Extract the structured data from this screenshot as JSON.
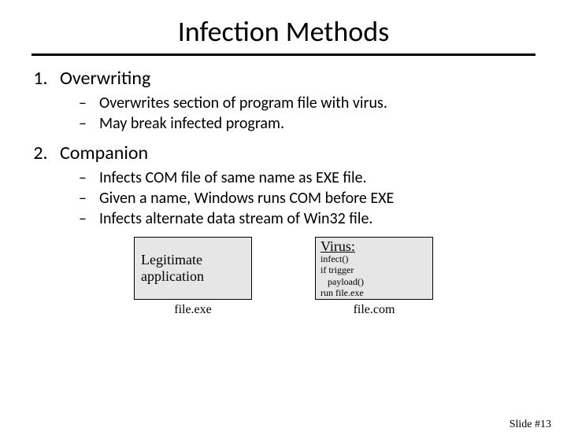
{
  "title": "Infection Methods",
  "list": {
    "item1": {
      "label": "Overwriting",
      "sub1": "Overwrites section of program file with virus.",
      "sub2": "May break infected program."
    },
    "item2": {
      "label": "Companion",
      "sub1": "Infects COM file of same name as EXE file.",
      "sub2": "Given a name, Windows runs COM before EXE",
      "sub3": "Infects alternate data stream of Win32 file."
    }
  },
  "boxes": {
    "legit": {
      "line1": "Legitimate",
      "line2": "application",
      "caption": "file.exe"
    },
    "virus": {
      "title": "Virus:",
      "code": "infect()\nif trigger\n   payload()\nrun file.exe",
      "caption": "file.com"
    }
  },
  "slidenum": "Slide #13"
}
